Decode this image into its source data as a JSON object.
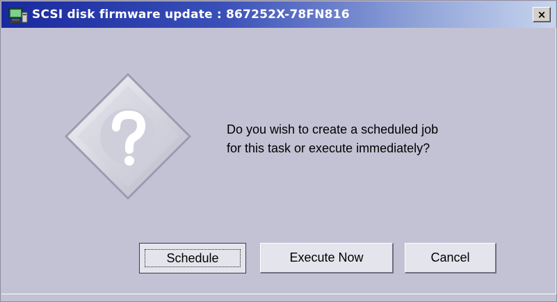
{
  "window": {
    "title": "SCSI disk firmware update : 867252X-78FN816",
    "close_label": "×"
  },
  "dialog": {
    "icon": "question-icon",
    "message_line1": "Do you wish to create a scheduled job",
    "message_line2": "for this task or execute immediately?"
  },
  "buttons": {
    "schedule": "Schedule",
    "execute_now": "Execute Now",
    "cancel": "Cancel"
  },
  "colors": {
    "titlebar_start": "#19299e",
    "titlebar_end": "#c8d4ee",
    "dialog_background": "#c2c2d4"
  }
}
